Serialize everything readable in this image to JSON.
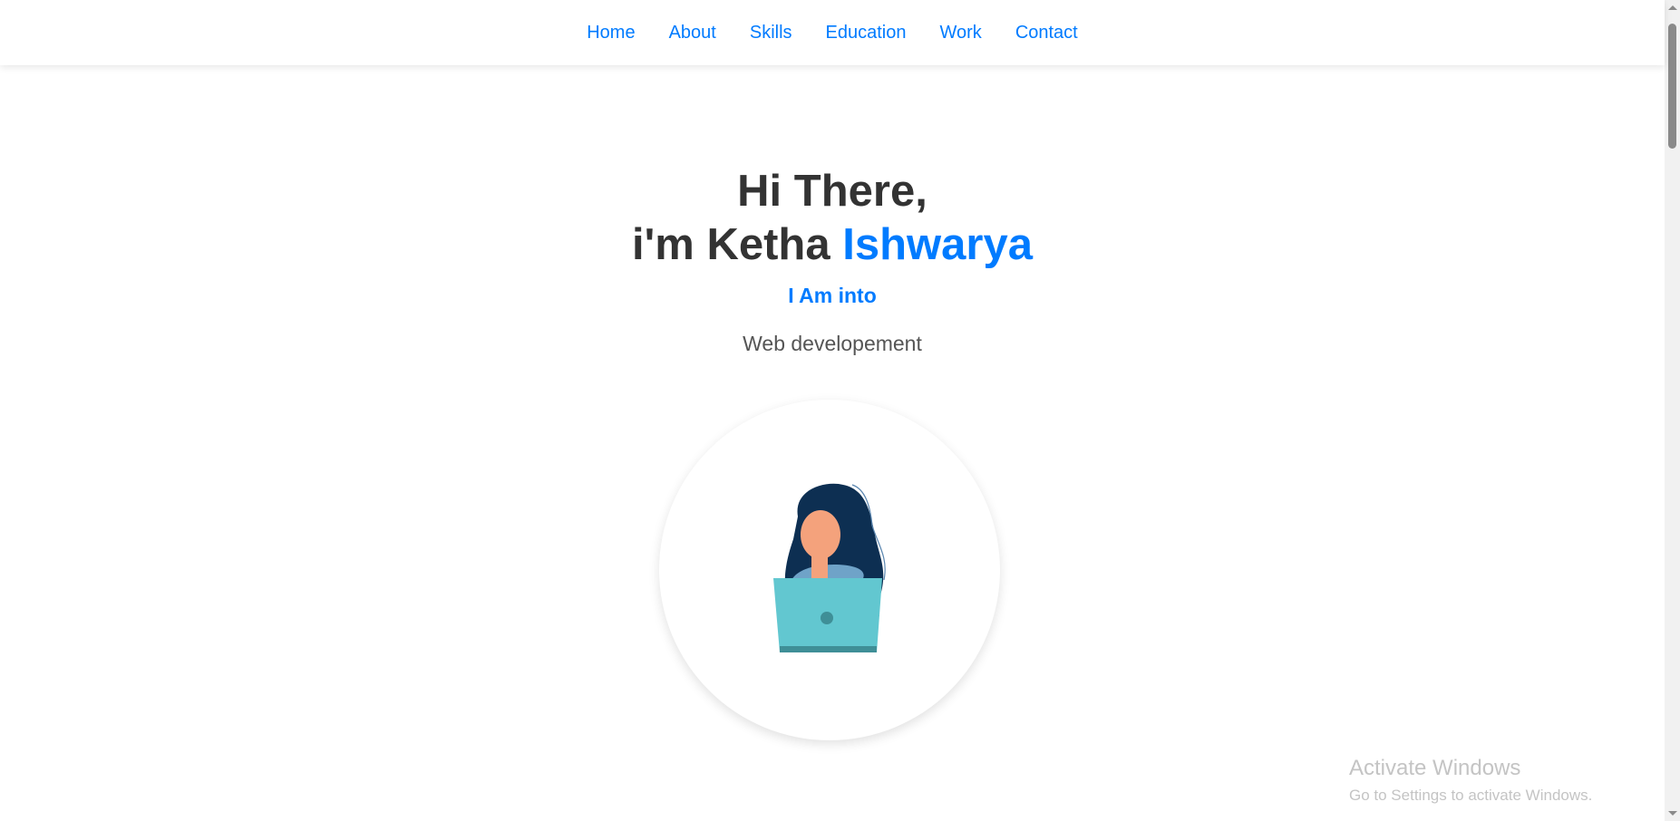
{
  "nav": {
    "items": [
      {
        "label": "Home"
      },
      {
        "label": "About"
      },
      {
        "label": "Skills"
      },
      {
        "label": "Education"
      },
      {
        "label": "Work"
      },
      {
        "label": "Contact"
      }
    ]
  },
  "hero": {
    "greeting": "Hi There,",
    "intro": "i'm Ketha ",
    "name": "Ishwarya",
    "into": "I Am into",
    "role": "Web developement",
    "image": "woman-with-laptop-illustration"
  },
  "colors": {
    "accent": "#007bff",
    "heading": "#333333",
    "text": "#555555"
  },
  "watermark": {
    "title": "Activate Windows",
    "subtitle": "Go to Settings to activate Windows."
  }
}
